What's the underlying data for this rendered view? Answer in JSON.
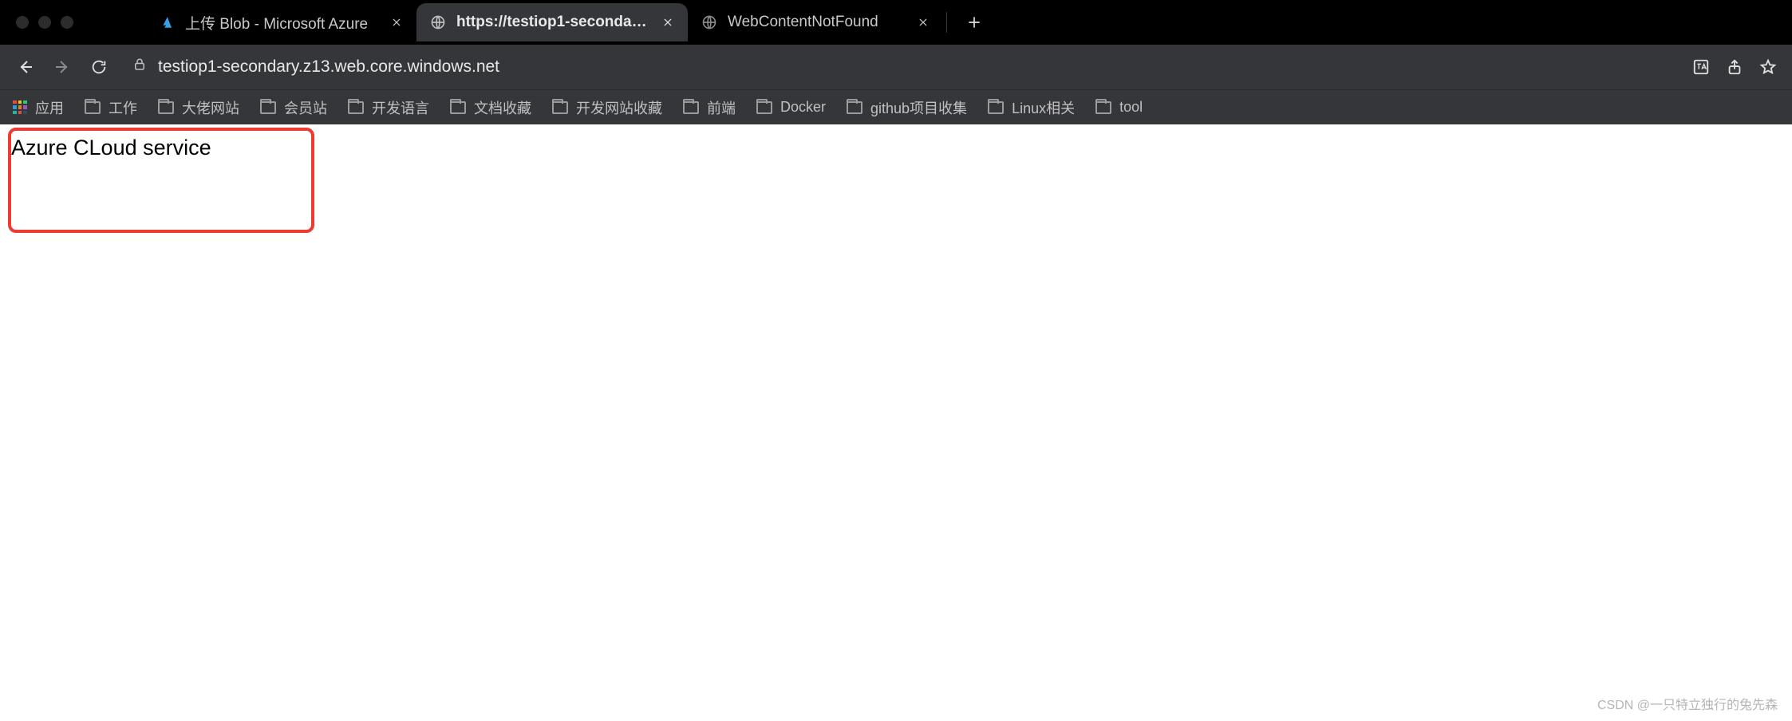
{
  "tabs": [
    {
      "title": "上传 Blob - Microsoft Azure",
      "favicon": "azure",
      "active": false
    },
    {
      "title": "https://testiop1-secondary.z13",
      "favicon": "globe",
      "active": true
    },
    {
      "title": "WebContentNotFound",
      "favicon": "globe",
      "active": false
    }
  ],
  "address": {
    "url": "testiop1-secondary.z13.web.core.windows.net"
  },
  "bookmarks": {
    "apps_label": "应用",
    "items": [
      {
        "label": "工作"
      },
      {
        "label": "大佬网站"
      },
      {
        "label": "会员站"
      },
      {
        "label": "开发语言"
      },
      {
        "label": "文档收藏"
      },
      {
        "label": "开发网站收藏"
      },
      {
        "label": "前端"
      },
      {
        "label": "Docker"
      },
      {
        "label": "github项目收集"
      },
      {
        "label": "Linux相关"
      },
      {
        "label": "tool"
      }
    ]
  },
  "page": {
    "body_text": "Azure CLoud service"
  },
  "watermark": "CSDN @一只特立独行的兔先森",
  "colors": {
    "highlight_border": "#ed3b2f"
  }
}
